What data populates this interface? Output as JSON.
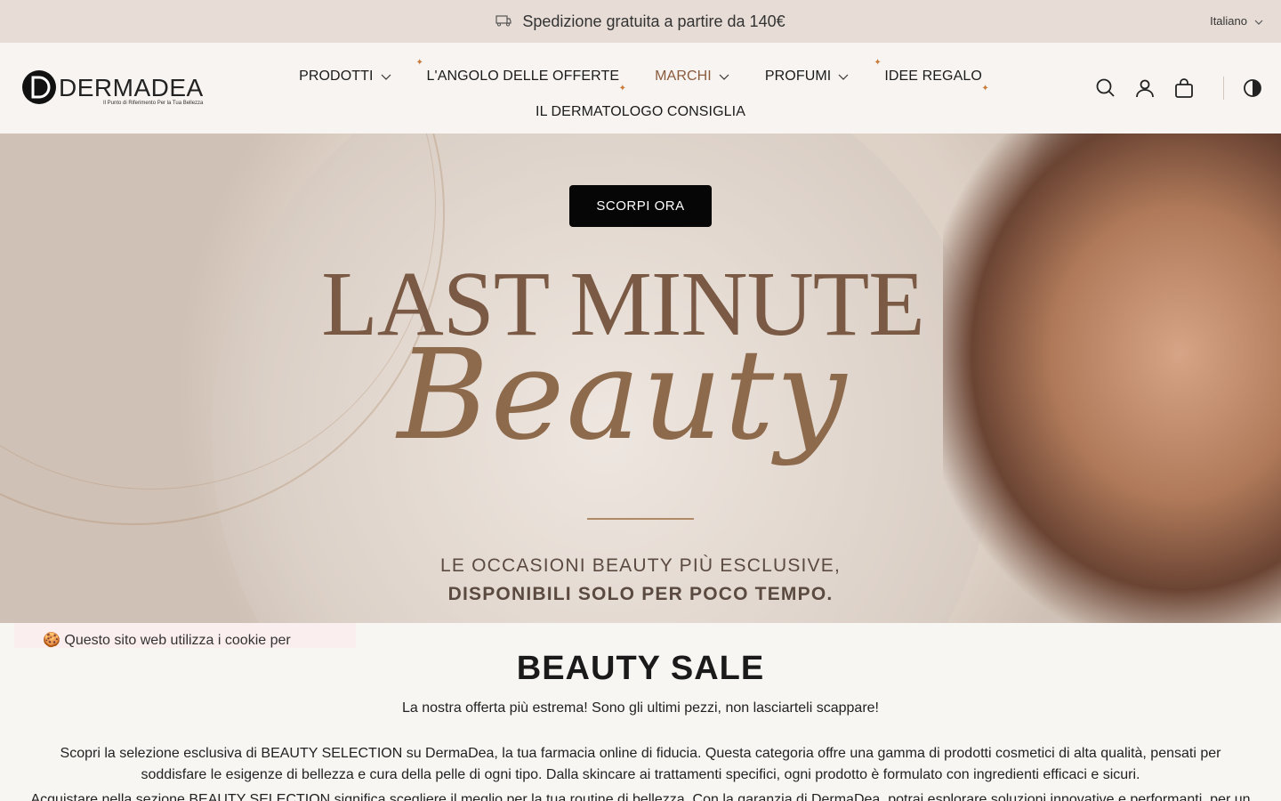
{
  "announcement": {
    "text": "Spedizione gratuita a partire da 140€",
    "icon": "truck-icon"
  },
  "language": {
    "selected": "Italiano"
  },
  "logo": {
    "brand": "DERMADEA",
    "tagline": "Il Punto di Riferimento Per la Tua Bellezza"
  },
  "nav": {
    "row1": [
      {
        "label": "PRODOTTI",
        "dropdown": true
      },
      {
        "label": "L'ANGOLO DELLE OFFERTE",
        "sparkle": true
      },
      {
        "label": "MARCHI",
        "dropdown": true,
        "active": true
      },
      {
        "label": "PROFUMI",
        "dropdown": true
      },
      {
        "label": "IDEE REGALO",
        "sparkle": true
      }
    ],
    "row2": [
      {
        "label": "IL DERMATOLOGO CONSIGLIA"
      }
    ]
  },
  "header_icons": [
    "search-icon",
    "account-icon",
    "cart-icon",
    "contrast-icon"
  ],
  "hero": {
    "button": "SCORPI ORA",
    "title": "LAST MINUTE",
    "script": "Beauty",
    "subtitle_line1": "LE OCCASIONI BEAUTY PIÙ ESCLUSIVE,",
    "subtitle_line2": "DISPONIBILI SOLO PER POCO TEMPO."
  },
  "cookie": {
    "text": "🍪 Questo sito web utilizza i cookie per"
  },
  "content": {
    "title": "BEAUTY SALE",
    "intro": "La nostra offerta più estrema! Sono gli ultimi pezzi, non lasciarteli scappare!",
    "paragraph1": "Scopri la selezione esclusiva di BEAUTY SELECTION su DermaDea, la tua farmacia online di fiducia. Questa categoria offre una gamma di prodotti cosmetici di alta qualità, pensati per soddisfare le esigenze di bellezza e cura della pelle di ogni tipo. Dalla skincare ai trattamenti specifici, ogni prodotto è formulato con ingredienti efficaci e sicuri.",
    "paragraph2": "Acquistare nella sezione BEAUTY SELECTION significa scegliere il meglio per la tua routine di bellezza. Con la garanzia di DermaDea, potrai esplorare soluzioni innovative e performanti, per un aspetto radioso e"
  },
  "colors": {
    "announce_bg": "#e7ddd6",
    "header_bg": "#f8f4f1",
    "accent": "#8a5a3c",
    "button_bg": "#060606"
  }
}
